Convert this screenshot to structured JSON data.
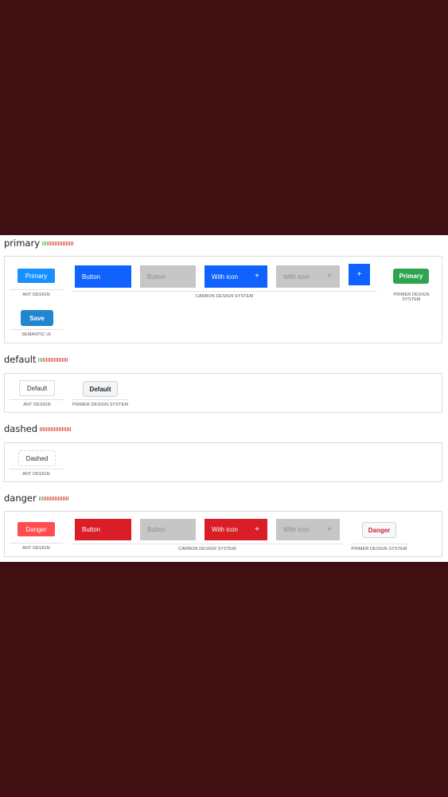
{
  "meter_colors": {
    "good": "#5cb85c",
    "bad": "#d9534f"
  },
  "sections": {
    "primary": {
      "heading": "primary",
      "ant": {
        "button": "Primary",
        "caption": "ANT DESIGN"
      },
      "carbon": {
        "button": "Button",
        "button_disabled": "Button",
        "with_icon": "With icon",
        "with_icon_disabled": "With icon",
        "icon_glyph": "+",
        "caption": "CARBON DESIGN SYSTEM"
      },
      "primer": {
        "button": "Primary",
        "caption": "PRIMER DESIGN SYSTEM"
      },
      "semantic": {
        "button": "Save",
        "caption": "SEMANTIC UI"
      }
    },
    "default": {
      "heading": "default",
      "ant": {
        "button": "Default",
        "caption": "ANT DESIGN"
      },
      "primer": {
        "button": "Default",
        "caption": "PRIMER DESIGN SYSTEM"
      }
    },
    "dashed": {
      "heading": "dashed",
      "ant": {
        "button": "Dashed",
        "caption": "ANT DESIGN"
      }
    },
    "danger": {
      "heading": "danger",
      "ant": {
        "button": "Danger",
        "caption": "ANT DESIGN"
      },
      "carbon": {
        "button": "Button",
        "button_disabled": "Button",
        "with_icon": "With icon",
        "with_icon_disabled": "With icon",
        "icon_glyph": "+",
        "caption": "CARBON DESIGN SYSTEM"
      },
      "primer": {
        "button": "Danger",
        "caption": "PRIMER DESIGN SYSTEM"
      }
    }
  }
}
